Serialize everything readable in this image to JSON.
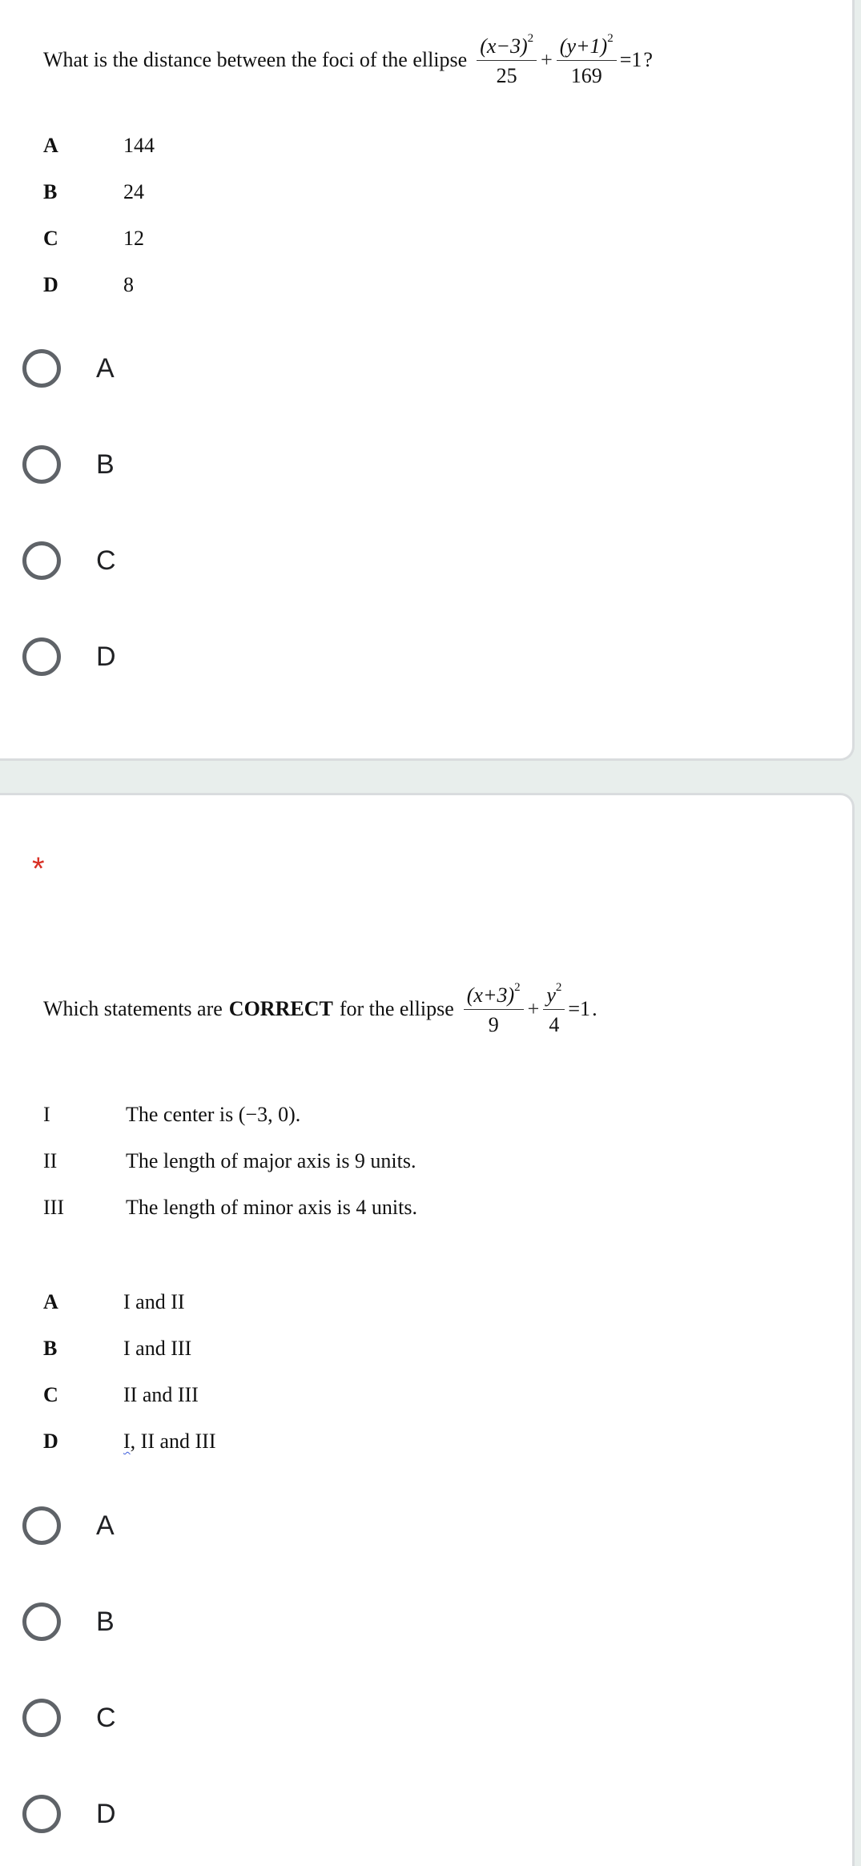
{
  "questions": [
    {
      "text": "What is the distance between the foci of the ellipse",
      "equation": {
        "term1_num": "(x−3)",
        "term1_exp": "2",
        "term1_den": "25",
        "op": "+",
        "term2_num": "(y+1)",
        "term2_exp": "2",
        "term2_den": "169",
        "rhs": "=1",
        "end": "?"
      },
      "options": [
        {
          "letter": "A",
          "value": "144"
        },
        {
          "letter": "B",
          "value": "24"
        },
        {
          "letter": "C",
          "value": "12"
        },
        {
          "letter": "D",
          "value": "8"
        }
      ],
      "choices": [
        "A",
        "B",
        "C",
        "D"
      ],
      "selected": null,
      "required": false
    },
    {
      "required_mark": "*",
      "text_prefix": "Which statements are",
      "text_bold": "CORRECT",
      "text_suffix": "for the ellipse",
      "equation": {
        "term1_num": "(x+3)",
        "term1_exp": "2",
        "term1_den": "9",
        "op": "+",
        "term2_num": "y",
        "term2_exp": "2",
        "term2_den": "4",
        "rhs": "=1",
        "end": "."
      },
      "statements": [
        {
          "num": "I",
          "text": "The center is (−3, 0)."
        },
        {
          "num": "II",
          "text": "The length of major axis is 9 units."
        },
        {
          "num": "III",
          "text": "The length of minor axis is 4 units."
        }
      ],
      "options": [
        {
          "letter": "A",
          "value": "I and II"
        },
        {
          "letter": "B",
          "value": "I and III"
        },
        {
          "letter": "C",
          "value": "II and III"
        },
        {
          "letter": "D",
          "value_part1": "I",
          "value_part2": ", II and III"
        }
      ],
      "choices": [
        "A",
        "B",
        "C",
        "D"
      ],
      "selected": null,
      "required": true
    }
  ],
  "colors": {
    "required": "#d93025",
    "radio_border": "#5f6368",
    "page_bg": "#e8eeec"
  }
}
